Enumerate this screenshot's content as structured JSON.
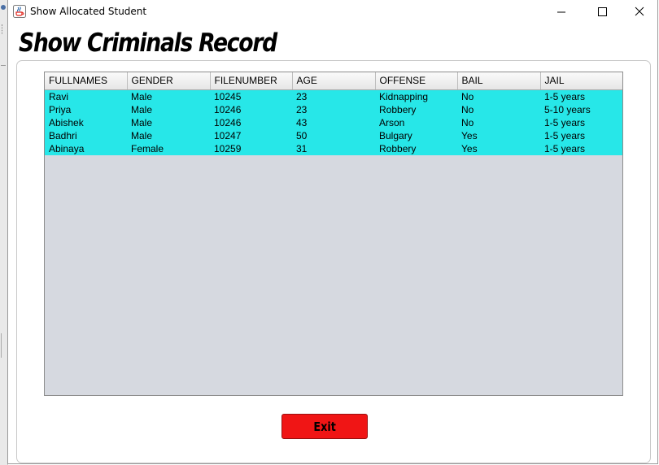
{
  "window": {
    "title": "Show Allocated Student",
    "icon": "java-coffee-icon",
    "controls": [
      "minimize-icon",
      "maximize-icon",
      "close-icon"
    ]
  },
  "page": {
    "heading": "Show Criminals Record"
  },
  "table": {
    "columns": [
      "FULLNAMES",
      "GENDER",
      "FILENUMBER",
      "AGE",
      "OFFENSE",
      "BAIL",
      "JAIL"
    ],
    "rows": [
      [
        "Ravi",
        "Male",
        "10245",
        "23",
        "Kidnapping",
        "No",
        "1-5 years"
      ],
      [
        "Priya",
        "Male",
        "10246",
        "23",
        "Robbery",
        "No",
        "5-10 years"
      ],
      [
        "Abishek",
        "Male",
        "10246",
        "43",
        "Arson",
        "No",
        "1-5 years"
      ],
      [
        "Badhri",
        "Male",
        "10247",
        "50",
        "Bulgary",
        "Yes",
        "1-5 years"
      ],
      [
        "Abinaya",
        "Female",
        "10259",
        "31",
        "Robbery",
        "Yes",
        "1-5 years"
      ]
    ],
    "row_color": "#27e7e8",
    "empty_area_color": "#d6d9e0"
  },
  "actions": {
    "exit_label": "Exit",
    "exit_color": "#f01515"
  }
}
